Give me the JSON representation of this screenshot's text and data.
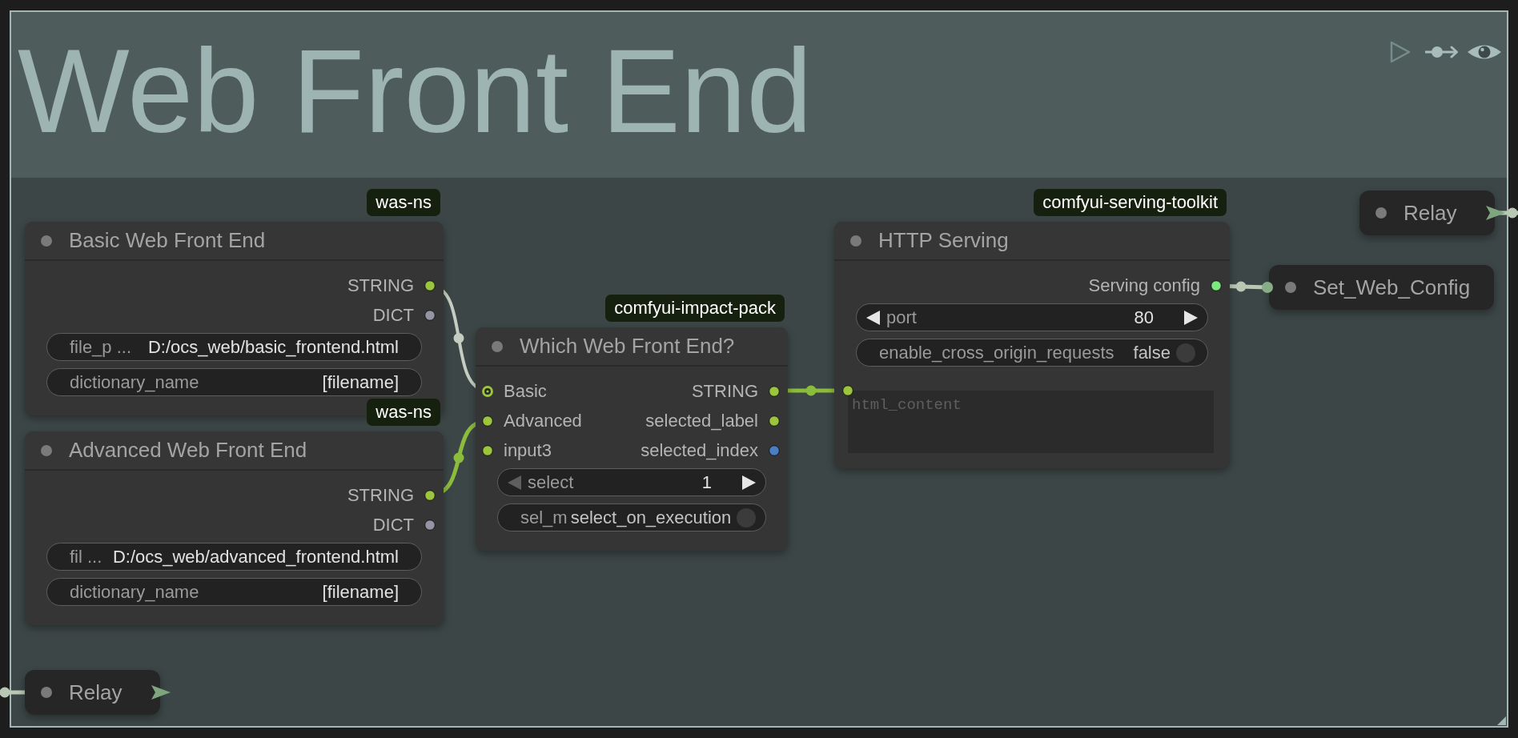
{
  "group": {
    "title": "Web Front End"
  },
  "nodes": [
    {
      "kind": "full",
      "badge": "was-ns",
      "title": "Basic Web Front End",
      "outputs": [
        {
          "label": "STRING",
          "color": "#9bc53d"
        },
        {
          "label": "DICT",
          "color": "#9494a4"
        }
      ],
      "widgets": [
        {
          "kind": "text",
          "label": "file_p ...",
          "value": "D:/ocs_web/basic_frontend.html"
        },
        {
          "kind": "text",
          "label": "dictionary_name",
          "value": "[filename]"
        }
      ]
    },
    {
      "kind": "full",
      "badge": "was-ns",
      "title": "Advanced Web Front End",
      "outputs": [
        {
          "label": "STRING",
          "color": "#9bc53d"
        },
        {
          "label": "DICT",
          "color": "#9494a4"
        }
      ],
      "widgets": [
        {
          "kind": "text",
          "label": "fil ...",
          "value": "D:/ocs_web/advanced_frontend.html"
        },
        {
          "kind": "text",
          "label": "dictionary_name",
          "value": "[filename]"
        }
      ]
    },
    {
      "kind": "full",
      "badge": "comfyui-impact-pack",
      "title": "Which Web Front End?",
      "inputs": [
        {
          "label": "Basic",
          "color": "#9bc53d",
          "hollow": true
        },
        {
          "label": "Advanced",
          "color": "#9bc53d",
          "hollow": false
        },
        {
          "label": "input3",
          "color": "#9bc53d",
          "hollow": false
        }
      ],
      "outputs": [
        {
          "label": "STRING",
          "color": "#9bc53d"
        },
        {
          "label": "selected_label",
          "color": "#9bc53d"
        },
        {
          "label": "selected_index",
          "color": "#4a7ec2"
        }
      ],
      "widgets": [
        {
          "kind": "number",
          "label": "select",
          "value": "1",
          "left_disabled": true
        },
        {
          "kind": "toggle",
          "label": "sel_m",
          "value": "select_on_execution",
          "on": false
        }
      ]
    },
    {
      "kind": "full",
      "badge": "comfyui-serving-toolkit",
      "title": "HTTP Serving",
      "outputs": [
        {
          "label": "Serving config",
          "color": "#7de87d"
        }
      ],
      "widgets": [
        {
          "kind": "number",
          "label": "port",
          "value": "80",
          "left_disabled": false
        },
        {
          "kind": "toggle",
          "label": "enable_cross_origin_requests",
          "value": "false",
          "on": false
        },
        {
          "kind": "textarea",
          "placeholder": "html_content",
          "color": "#9bc53d"
        }
      ]
    },
    {
      "kind": "collapsed",
      "title": "Relay",
      "outputs": [
        {
          "color": "#7ea57e"
        }
      ]
    },
    {
      "kind": "collapsed",
      "title": "Set_Web_Config",
      "inputs": [
        {
          "color": "#86ad86"
        }
      ]
    },
    {
      "kind": "collapsed",
      "title": "Relay",
      "outputs": [
        {
          "color": "#7ea57e"
        }
      ]
    }
  ],
  "links": [
    {
      "color": "#c5cdc2"
    },
    {
      "color": "#8cbc3b"
    },
    {
      "color": "#8cbc3b"
    },
    {
      "color": "#b8c8b4"
    },
    {
      "color": "#b8c8b4"
    },
    {
      "color": "#b8c8b4"
    }
  ]
}
